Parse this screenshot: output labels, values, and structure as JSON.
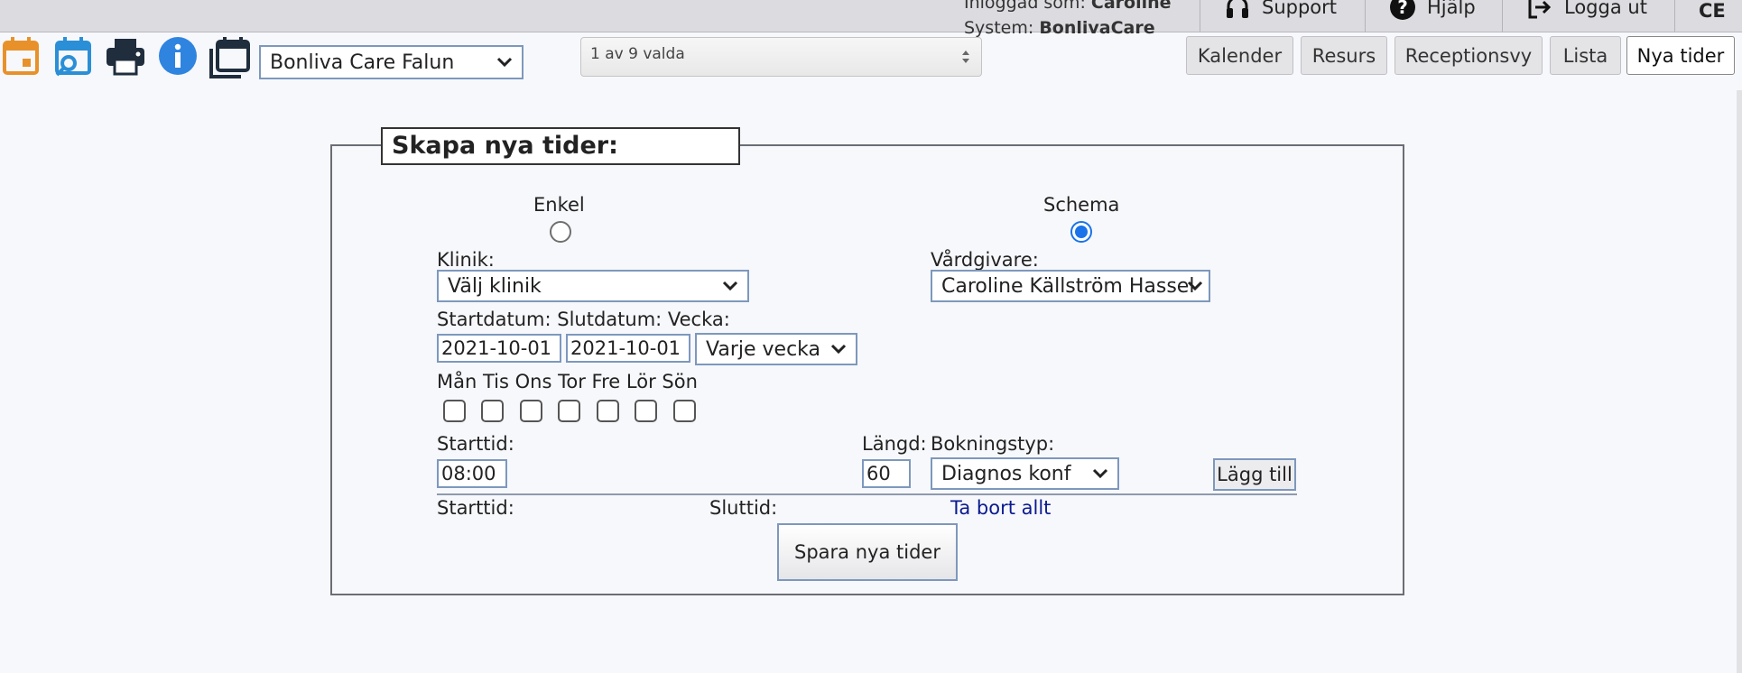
{
  "header": {
    "logged_in_label": "Inloggad som:",
    "logged_in_user": "Caroline",
    "system_label": "System:",
    "system_name": "BonlivaCare",
    "support_label": "Support",
    "help_label": "Hjälp",
    "logout_label": "Logga ut",
    "ce_mark": "CE"
  },
  "toolbar": {
    "clinic_select": "Bonliva Care Falun",
    "multi_select": "1 av 9 valda"
  },
  "nav_tabs": [
    {
      "label": "Kalender"
    },
    {
      "label": "Resurs"
    },
    {
      "label": "Receptionsvy"
    },
    {
      "label": "Lista"
    },
    {
      "label": "Nya tider"
    }
  ],
  "form": {
    "title": "Skapa nya tider:",
    "mode_single": "Enkel",
    "mode_schedule": "Schema",
    "clinic_label": "Klinik:",
    "clinic_value": "Välj klinik",
    "caregiver_label": "Vårdgivare:",
    "caregiver_value": "Caroline Källström Hassel",
    "date_labels": "Startdatum: Slutdatum: Vecka:",
    "start_date": "2021-10-01",
    "end_date": "2021-10-01",
    "week_value": "Varje vecka",
    "days": [
      "Mån",
      "Tis",
      "Ons",
      "Tor",
      "Fre",
      "Lör",
      "Sön"
    ],
    "start_time_label": "Starttid:",
    "start_time_value": "08:00",
    "length_label": "Längd:",
    "length_value": "60",
    "booking_type_label": "Bokningstyp:",
    "booking_type_value": "Diagnos konf",
    "add_button": "Lägg till",
    "list_start_label": "Starttid:",
    "list_end_label": "Sluttid:",
    "remove_all_link": "Ta bort allt",
    "save_button": "Spara nya tider"
  }
}
